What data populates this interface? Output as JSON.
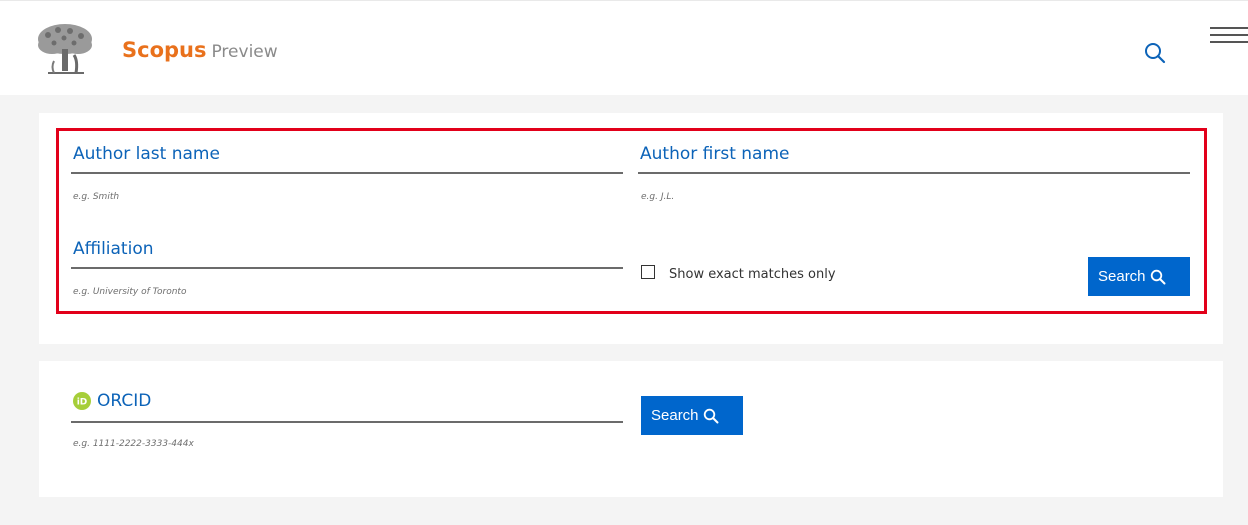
{
  "header": {
    "brand_name": "Scopus",
    "brand_sub": "Preview",
    "logo_icon": "elsevier-tree-logo",
    "search_icon": "search-icon",
    "menu_icon": "hamburger-menu-icon",
    "accent_color": "#e9711c",
    "link_color": "#0c63b8"
  },
  "author_search": {
    "last_name": {
      "label": "Author last name",
      "hint": "e.g. Smith",
      "value": ""
    },
    "first_name": {
      "label": "Author first name",
      "hint": "e.g. J.L.",
      "value": ""
    },
    "affiliation": {
      "label": "Affiliation",
      "hint": "e.g. University of Toronto",
      "value": ""
    },
    "exact_matches_label": "Show exact matches only",
    "exact_matches_checked": false,
    "search_button": "Search",
    "highlight_color": "#e2001a"
  },
  "orcid_search": {
    "label": "ORCID",
    "hint": "e.g. 1111-2222-3333-444x",
    "value": "",
    "icon": "orcid-icon",
    "search_button": "Search"
  },
  "colors": {
    "button": "#0066cc",
    "page_background": "#f4f4f4",
    "orcid_green": "#a6ce39"
  }
}
